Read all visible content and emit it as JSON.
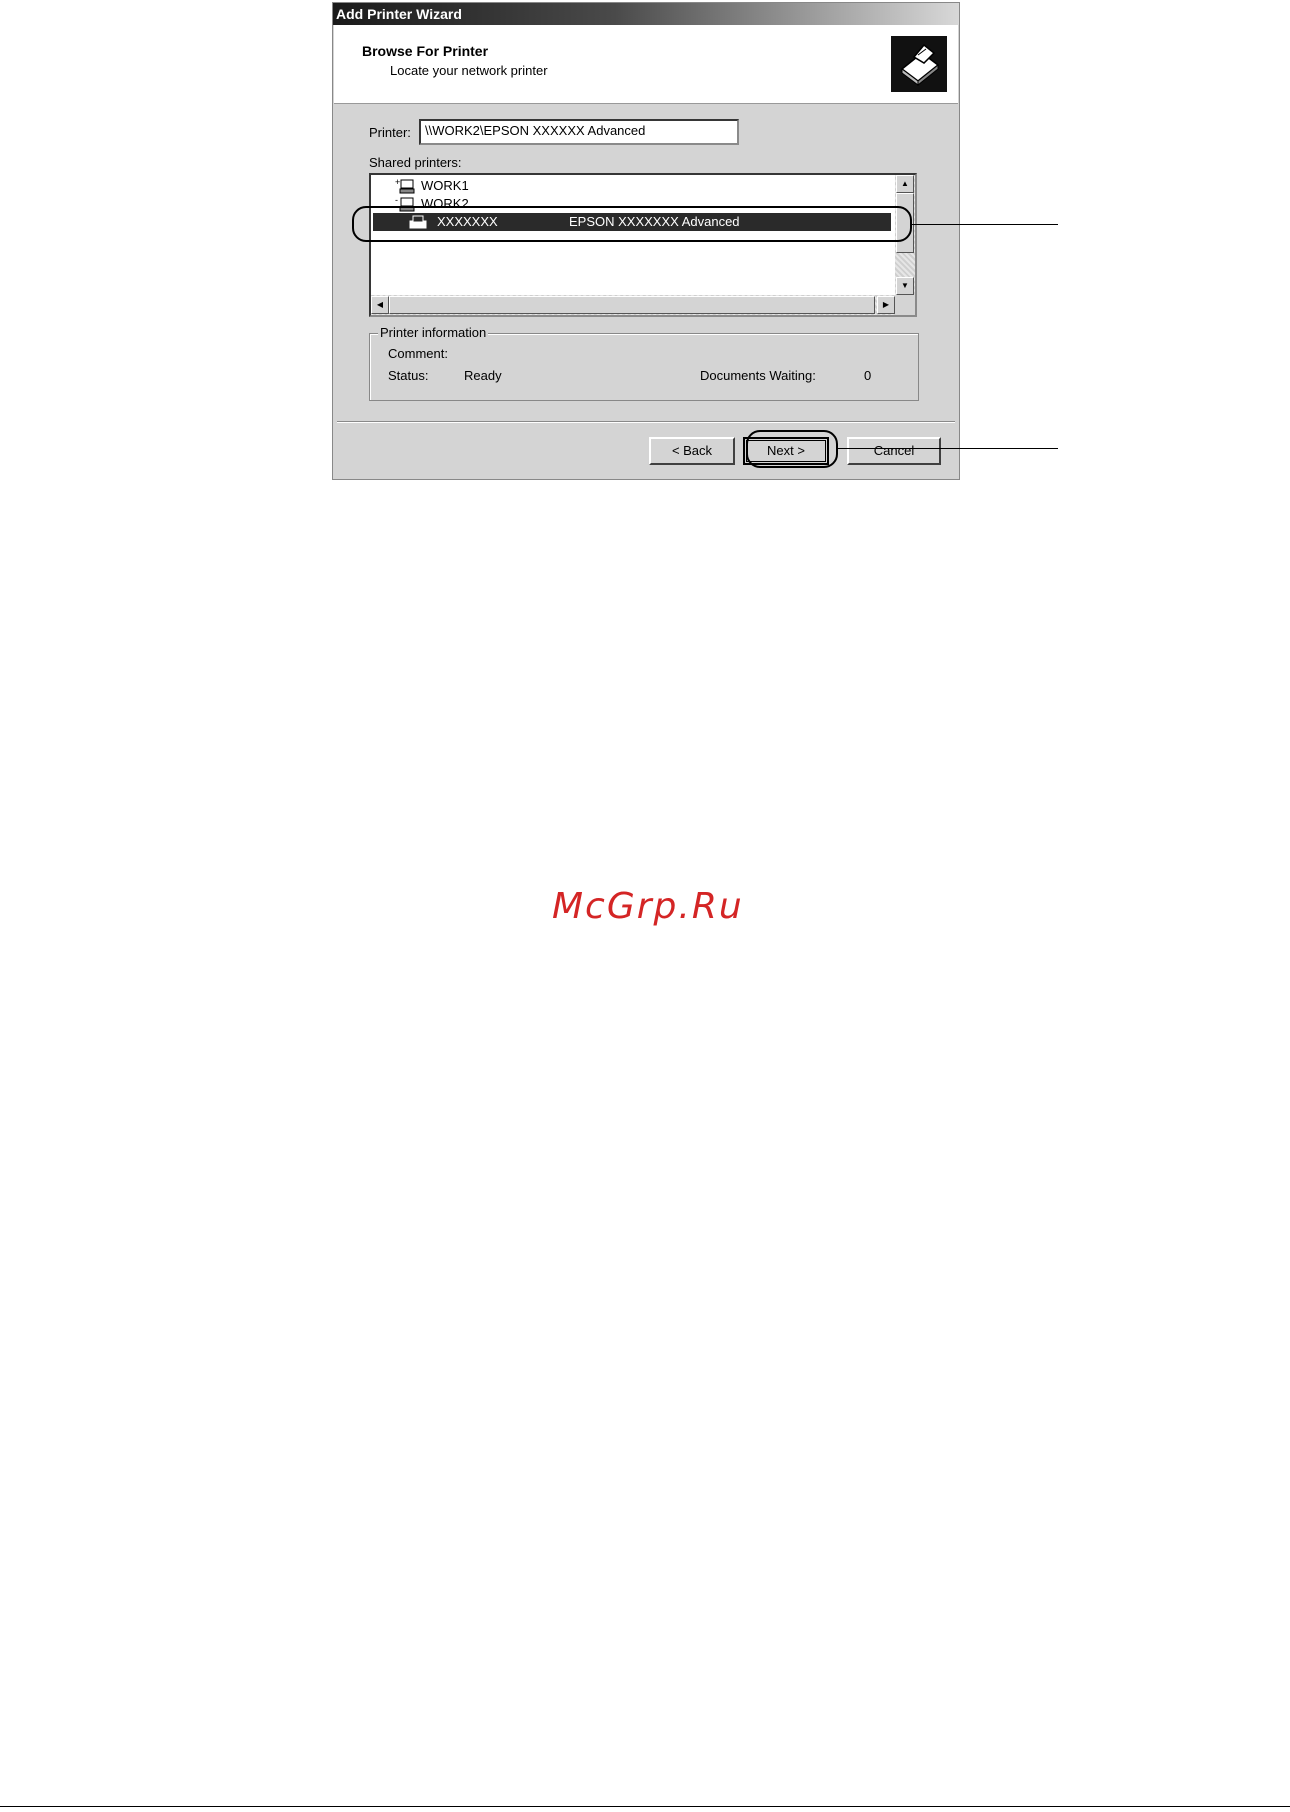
{
  "window": {
    "title": "Add Printer Wizard"
  },
  "header": {
    "title": "Browse For Printer",
    "subtitle": "Locate your network printer",
    "icon": "printer-wizard-icon"
  },
  "printer_field": {
    "label": "Printer:",
    "value": "\\\\WORK2\\EPSON XXXXXX Advanced"
  },
  "shared_printers": {
    "label": "Shared printers:",
    "items": [
      {
        "name": "WORK1",
        "icon": "computer-icon"
      },
      {
        "name": "WORK2",
        "icon": "computer-icon"
      },
      {
        "name": "XXXXXXX",
        "description": "EPSON XXXXXXX Advanced",
        "icon": "printer-icon",
        "selected": true
      }
    ]
  },
  "printer_info": {
    "legend": "Printer information",
    "comment_label": "Comment:",
    "comment_value": "",
    "status_label": "Status:",
    "status_value": "Ready",
    "docs_label": "Documents Waiting:",
    "docs_value": "0"
  },
  "buttons": {
    "back": "< Back",
    "next": "Next >",
    "cancel": "Cancel"
  },
  "watermark": "McGrp.Ru"
}
